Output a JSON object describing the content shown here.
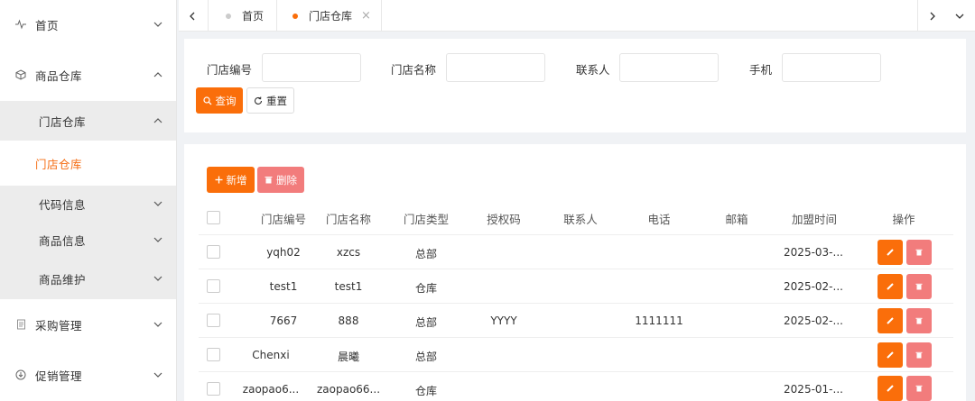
{
  "sidebar": {
    "items": [
      {
        "label": "首页",
        "icon": "pulse-icon"
      },
      {
        "label": "商品仓库",
        "icon": "cube-icon"
      },
      {
        "label": "门店仓库"
      },
      {
        "label": "门店仓库"
      },
      {
        "label": "代码信息"
      },
      {
        "label": "商品信息"
      },
      {
        "label": "商品维护"
      },
      {
        "label": "采购管理",
        "icon": "document-icon"
      },
      {
        "label": "促销管理",
        "icon": "download-circle-icon"
      }
    ]
  },
  "tabs": {
    "items": [
      {
        "label": "首页"
      },
      {
        "label": "门店仓库"
      }
    ]
  },
  "search": {
    "store_code_label": "门店编号",
    "store_code_value": "",
    "store_name_label": "门店名称",
    "store_name_value": "",
    "contact_label": "联系人",
    "contact_value": "",
    "phone_label": "手机",
    "phone_value": "",
    "query_label": "查询",
    "reset_label": "重置"
  },
  "toolbar": {
    "add_label": "新增",
    "delete_label": "删除"
  },
  "table": {
    "headers": [
      "门店编号",
      "门店名称",
      "门店类型",
      "授权码",
      "联系人",
      "电话",
      "邮箱",
      "加盟时间",
      "操作"
    ],
    "rows": [
      [
        "yqh02",
        "xzcs",
        "总部",
        "",
        "",
        "",
        "",
        "2025-03-..."
      ],
      [
        "test1",
        "test1",
        "仓库",
        "",
        "",
        "",
        "",
        "2025-02-..."
      ],
      [
        "7667",
        "888",
        "总部",
        "YYYY",
        "",
        "1111111",
        "",
        "2025-02-..."
      ],
      [
        "Chenxi",
        "晨曦",
        "总部",
        "",
        "",
        "",
        "",
        ""
      ],
      [
        "zaopao6...",
        "zaopao66...",
        "仓库",
        "",
        "",
        "",
        "",
        "2025-01-..."
      ]
    ]
  },
  "colors": {
    "accent": "#fa6e0a",
    "danger": "#f27c7c",
    "active_text": "#f56c12"
  }
}
